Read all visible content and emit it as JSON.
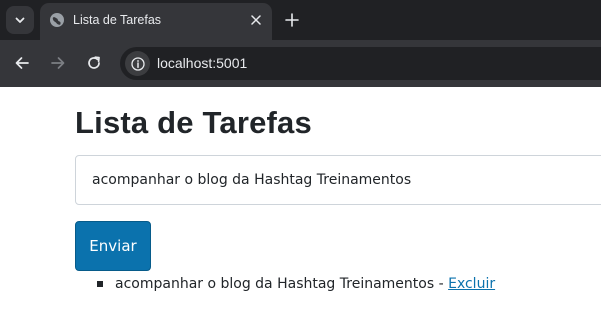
{
  "browser": {
    "tab": {
      "title": "Lista de Tarefas"
    },
    "address_bar": {
      "url": "localhost:5001"
    }
  },
  "page": {
    "title": "Lista de Tarefas",
    "form": {
      "input_value": "acompanhar o blog da Hashtag Treinamentos",
      "submit_label": "Enviar"
    },
    "tasks": [
      {
        "text": "acompanhar o blog da Hashtag Treinamentos",
        "separator": " - ",
        "delete_label": "Excluir"
      }
    ]
  },
  "colors": {
    "tabstrip_bg": "#202124",
    "toolbar_bg": "#35363a",
    "button_primary": "#0b72ad",
    "link": "#0b72ad",
    "text": "#212529"
  },
  "icons": {
    "tab_list": "chevron-down-icon",
    "favicon": "globe-icon",
    "tab_close": "close-icon",
    "new_tab": "plus-icon",
    "back": "arrow-left-icon",
    "forward": "arrow-right-icon",
    "reload": "reload-icon",
    "site_info": "info-icon"
  }
}
